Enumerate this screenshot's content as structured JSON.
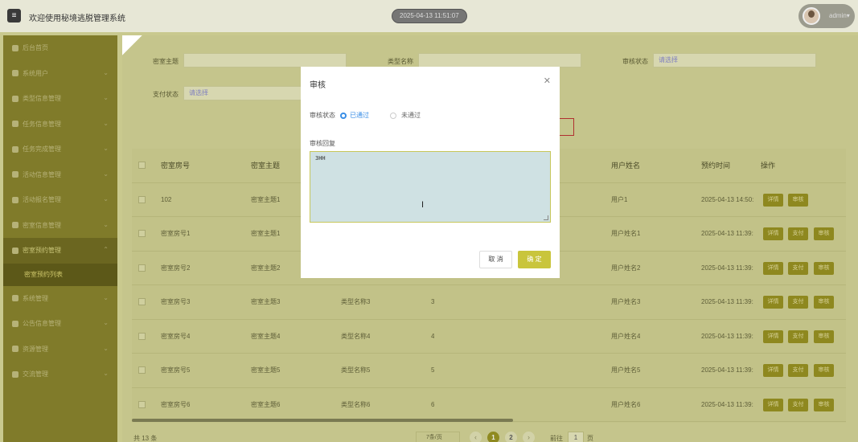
{
  "header": {
    "title": "欢迎使用秘境逃脱管理系统",
    "datetime": "2025-04-13 11:51:07",
    "username": "admin"
  },
  "sidebar": {
    "items": [
      {
        "label": "后台首页",
        "icon": "home-icon"
      },
      {
        "label": "系统用户",
        "icon": "user-icon"
      },
      {
        "label": "类型信息管理",
        "icon": "grid-icon"
      },
      {
        "label": "任务信息管理",
        "icon": "grid-icon"
      },
      {
        "label": "任务完成管理",
        "icon": "grid-icon"
      },
      {
        "label": "活动信息管理",
        "icon": "grid-icon"
      },
      {
        "label": "活动报名管理",
        "icon": "grid-icon"
      },
      {
        "label": "密室信息管理",
        "icon": "grid-icon"
      },
      {
        "label": "密室预约管理",
        "icon": "grid-icon"
      },
      {
        "label": "系统管理",
        "icon": "gear-icon"
      },
      {
        "label": "公告信息管理",
        "icon": "doc-icon"
      },
      {
        "label": "资源管理",
        "icon": "plus-icon"
      },
      {
        "label": "交流管理",
        "icon": "chat-icon"
      }
    ],
    "active_sub": "密室预约列表"
  },
  "filters": {
    "theme_label": "密室主题",
    "type_label": "类型名称",
    "audit_label": "审核状态",
    "audit_placeholder": "请选择",
    "pay_label": "支付状态",
    "pay_placeholder": "请选择"
  },
  "table": {
    "headers": [
      "密室房号",
      "密室主题",
      "",
      "",
      "用户姓名",
      "预约时间",
      "操作"
    ],
    "rows": [
      {
        "room": "102",
        "theme": "密室主题1",
        "type": "",
        "num": "",
        "user": "用户1",
        "time": "2025-04-13 14:50:",
        "ops": [
          "详情",
          "审核"
        ]
      },
      {
        "room": "密室房号1",
        "theme": "密室主题1",
        "type": "",
        "num": "",
        "user": "用户姓名1",
        "time": "2025-04-13 11:39:",
        "ops": [
          "详情",
          "支付",
          "审核"
        ]
      },
      {
        "room": "密室房号2",
        "theme": "密室主题2",
        "type": "",
        "num": "",
        "user": "用户姓名2",
        "time": "2025-04-13 11:39:",
        "ops": [
          "详情",
          "支付",
          "审核"
        ]
      },
      {
        "room": "密室房号3",
        "theme": "密室主题3",
        "type": "类型名称3",
        "num": "3",
        "user": "用户姓名3",
        "time": "2025-04-13 11:39:",
        "ops": [
          "详情",
          "支付",
          "审核"
        ]
      },
      {
        "room": "密室房号4",
        "theme": "密室主题4",
        "type": "类型名称4",
        "num": "4",
        "user": "用户姓名4",
        "time": "2025-04-13 11:39:",
        "ops": [
          "详情",
          "支付",
          "审核"
        ]
      },
      {
        "room": "密室房号5",
        "theme": "密室主题5",
        "type": "类型名称5",
        "num": "5",
        "user": "用户姓名5",
        "time": "2025-04-13 11:39:",
        "ops": [
          "详情",
          "支付",
          "审核"
        ]
      },
      {
        "room": "密室房号6",
        "theme": "密室主题6",
        "type": "类型名称6",
        "num": "6",
        "user": "用户姓名6",
        "time": "2025-04-13 11:39:",
        "ops": [
          "详情",
          "支付",
          "审核"
        ]
      }
    ]
  },
  "pager": {
    "total": "共 13 条",
    "page_size": "7条/页",
    "pages": [
      "1",
      "2"
    ],
    "goto_label": "前往",
    "goto_value": "1",
    "page_suffix": "页"
  },
  "modal": {
    "title": "审核",
    "status_label": "审核状态",
    "option_pass": "已通过",
    "option_fail": "未通过",
    "reply_label": "审核回复",
    "reply_value": "3HH",
    "cancel_label": "取 消",
    "ok_label": "确 定"
  },
  "colors": {
    "accent": "#c9c53c",
    "sidebar": "#807b2a",
    "radio_active": "#3a8ee6"
  }
}
